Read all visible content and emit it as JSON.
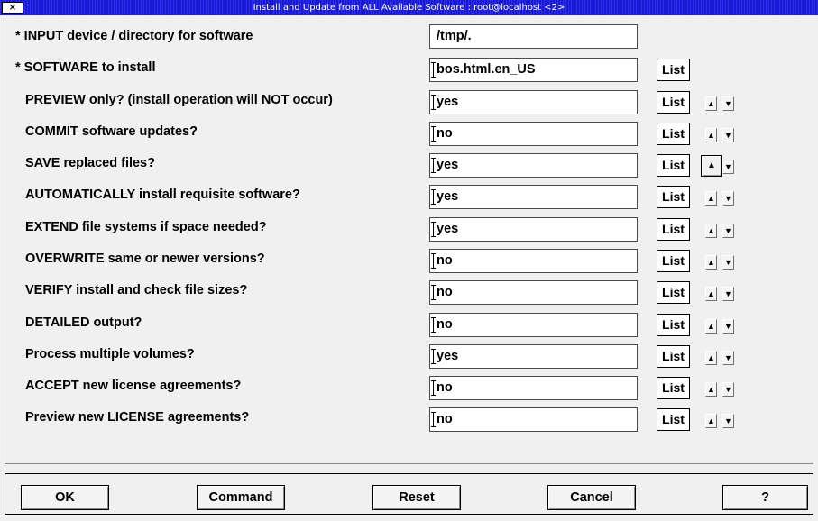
{
  "window": {
    "title": "Install and Update from ALL Available Software : root@localhost <2>",
    "close_glyph": "×",
    "title_color": "#1818d8"
  },
  "rows": [
    {
      "label": "* INPUT device / directory for software",
      "value": "/tmp/.",
      "has_list": false,
      "has_spin": false
    },
    {
      "label": "* SOFTWARE to install",
      "value": "bos.html.en_US",
      "has_list": true,
      "has_spin": false
    },
    {
      "label": "PREVIEW only? (install operation will NOT occur)",
      "value": "yes",
      "has_list": true,
      "has_spin": true
    },
    {
      "label": "COMMIT software updates?",
      "value": "no",
      "has_list": true,
      "has_spin": true
    },
    {
      "label": "SAVE replaced files?",
      "value": "yes",
      "has_list": true,
      "has_spin": true
    },
    {
      "label": "AUTOMATICALLY install requisite software?",
      "value": "yes",
      "has_list": true,
      "has_spin": true
    },
    {
      "label": "EXTEND file systems if space needed?",
      "value": "yes",
      "has_list": true,
      "has_spin": true
    },
    {
      "label": "OVERWRITE same or newer versions?",
      "value": "no",
      "has_list": true,
      "has_spin": true
    },
    {
      "label": "VERIFY install and check file sizes?",
      "value": "no",
      "has_list": true,
      "has_spin": true
    },
    {
      "label": "DETAILED output?",
      "value": "no",
      "has_list": true,
      "has_spin": true
    },
    {
      "label": "Process multiple volumes?",
      "value": "yes",
      "has_list": true,
      "has_spin": true
    },
    {
      "label": "ACCEPT new license agreements?",
      "value": "no",
      "has_list": true,
      "has_spin": true
    },
    {
      "label": "Preview new LICENSE agreements?",
      "value": "no",
      "has_list": true,
      "has_spin": true
    }
  ],
  "list_label": "List",
  "spin": {
    "up_glyph": "▲",
    "down_glyph": "▼",
    "up_icon": "arrow-up-icon",
    "down_icon": "arrow-down-icon"
  },
  "buttons": {
    "ok": "OK",
    "command": "Command",
    "reset": "Reset",
    "cancel": "Cancel",
    "help": "?"
  }
}
